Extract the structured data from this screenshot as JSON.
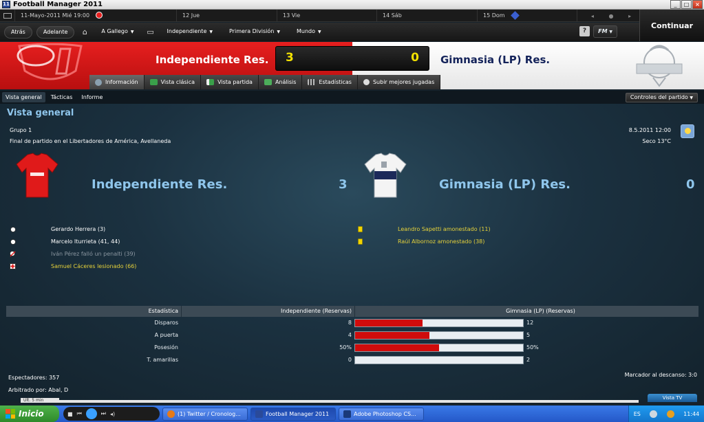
{
  "window": {
    "title": "Football Manager 2011"
  },
  "calendar": {
    "current": "11-Mayo-2011  Mié 19:00",
    "days": [
      "12 Jue",
      "13 Vie",
      "14 Sáb",
      "15 Dom"
    ]
  },
  "continue_label": "Continuar",
  "nav": {
    "back": "Atrás",
    "forward": "Adelante",
    "manager": "A Gallego",
    "club": "Independiente",
    "league": "Primera División",
    "world": "Mundo",
    "help": "?",
    "fm": "FM"
  },
  "match": {
    "home_team": "Independiente Res.",
    "away_team": "Gimnasia (LP) Res.",
    "home_score": "3",
    "away_score": "0"
  },
  "tabs": [
    "Información",
    "Vista clásica",
    "Vista partida",
    "Análisis",
    "Estadísticas",
    "Subir mejores jugadas"
  ],
  "subtabs": [
    "Vista general",
    "Tácticas",
    "Informe"
  ],
  "controls_label": "Controles del partido",
  "overview": {
    "title": "Vista general",
    "group": "Grupo 1",
    "venue": "Final de partido en el Libertadores de América, Avellaneda",
    "date": "8.5.2011 12:00",
    "weather": "Seco 13°C"
  },
  "home_events": [
    {
      "icon": "ball-icon",
      "text": "Gerardo Herrera (3)",
      "color": "#ffffff"
    },
    {
      "icon": "ball-icon",
      "text": "Marcelo Iturrieta (41, 44)",
      "color": "#ffffff"
    },
    {
      "icon": "missed-penalty-icon",
      "text": "Iván Pérez falló un penalti (39)",
      "color": "#8a96a0"
    },
    {
      "icon": "injury-icon",
      "text": "Samuel Cáceres lesionado (66)",
      "color": "#e6d23a"
    }
  ],
  "away_events": [
    {
      "icon": "yellow-card-icon",
      "text": "Leandro Sapetti amonestado (11)",
      "color": "#e6d23a"
    },
    {
      "icon": "yellow-card-icon",
      "text": "Raúl Albornoz amonestado (38)",
      "color": "#e6d23a"
    }
  ],
  "stats": {
    "headers": [
      "Estadística",
      "Independiente (Reservas)",
      "Gimnasia (LP) (Reservas)"
    ],
    "rows": [
      {
        "label": "Disparos",
        "home": "8",
        "away": "12",
        "home_share": 0.4
      },
      {
        "label": "A puerta",
        "home": "4",
        "away": "5",
        "home_share": 0.444
      },
      {
        "label": "Posesión",
        "home": "50%",
        "away": "50%",
        "home_share": 0.5
      },
      {
        "label": "T. amarillas",
        "home": "0",
        "away": "2",
        "home_share": 0.0
      }
    ]
  },
  "footer": {
    "attendance": "Espectadores: 357",
    "referee": "Arbitrado por: Abal, D",
    "halftime": "Marcador al descanso: 3:0",
    "last_min": "Últ. 5 min",
    "tv": "Vista TV"
  },
  "taskbar": {
    "start": "Inicio",
    "items": [
      "(1) Twitter / Cronolog...",
      "Football Manager 2011",
      "Adobe Photoshop CS..."
    ],
    "lang": "ES",
    "time": "11:44"
  },
  "colors": {
    "home_red": "#e61f1f",
    "away_navy": "#14235a",
    "accent_blue": "#8fc6ec",
    "score_yellow": "#f2e100"
  }
}
